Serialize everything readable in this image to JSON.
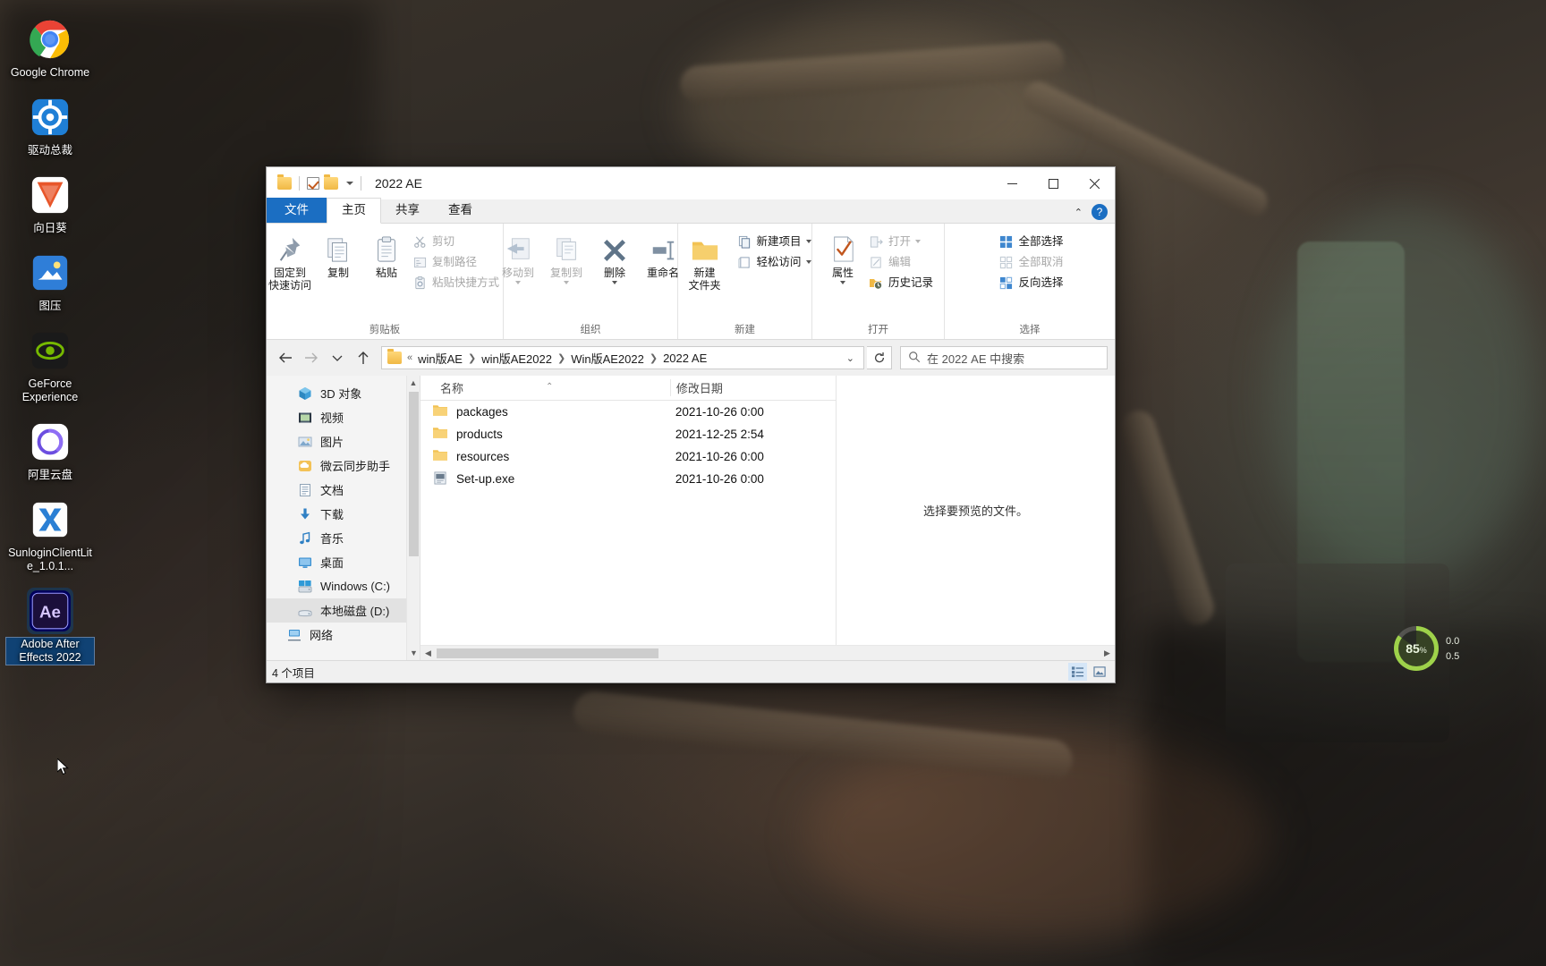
{
  "desktop": {
    "icons": [
      {
        "label": "Google Chrome",
        "icon": "chrome-icon",
        "selected": false
      },
      {
        "label": "驱动总裁",
        "icon": "driver-tool-icon",
        "selected": false
      },
      {
        "label": "向日葵",
        "icon": "sunflower-remote-icon",
        "selected": false
      },
      {
        "label": "图压",
        "icon": "image-compress-icon",
        "selected": false
      },
      {
        "label": "GeForce Experience",
        "icon": "geforce-experience-icon",
        "selected": false
      },
      {
        "label": "阿里云盘",
        "icon": "aliyun-drive-icon",
        "selected": false
      },
      {
        "label": "SunloginClientLite_1.0.1...",
        "icon": "sunlogin-installer-icon",
        "selected": false
      },
      {
        "label": "Adobe After Effects 2022",
        "icon": "after-effects-icon",
        "selected": true
      }
    ],
    "widget": {
      "percent": "85",
      "percent_unit": "%",
      "line1": "0.0",
      "line2": "0.5"
    }
  },
  "window": {
    "title": "2022 AE",
    "quick_access": {
      "folder_icon": "folder-icon",
      "properties_icon": "properties-check-icon",
      "new_folder_icon": "new-folder-icon",
      "customize_caret": "chevron-down-icon"
    },
    "controls": {
      "minimize": "−",
      "maximize": "□",
      "close": "✕"
    }
  },
  "ribbon": {
    "tabs": [
      {
        "label": "文件",
        "type": "file"
      },
      {
        "label": "主页",
        "type": "active"
      },
      {
        "label": "共享",
        "type": "normal"
      },
      {
        "label": "查看",
        "type": "normal"
      }
    ],
    "collapse_icon": "chevron-up-icon",
    "help_label": "?",
    "groups": [
      {
        "name": "剪贴板",
        "big_buttons": [
          {
            "label_line1": "固定到",
            "label_line2": "快速访问",
            "icon": "pin-icon",
            "dim": false
          },
          {
            "label_line1": "复制",
            "label_line2": "",
            "icon": "copy-icon",
            "dim": false
          },
          {
            "label_line1": "粘贴",
            "label_line2": "",
            "icon": "paste-icon",
            "dim": false
          }
        ],
        "small_buttons": [
          {
            "label": "剪切",
            "icon": "scissors-icon",
            "dim": true,
            "caret": false
          },
          {
            "label": "复制路径",
            "icon": "copy-path-icon",
            "dim": true,
            "caret": false
          },
          {
            "label": "粘贴快捷方式",
            "icon": "paste-shortcut-icon",
            "dim": true,
            "caret": false
          }
        ]
      },
      {
        "name": "组织",
        "big_buttons": [
          {
            "label_line1": "移动到",
            "label_line2": "",
            "icon": "move-to-icon",
            "dim": true,
            "caret": true
          },
          {
            "label_line1": "复制到",
            "label_line2": "",
            "icon": "copy-to-icon",
            "dim": true,
            "caret": true
          },
          {
            "label_line1": "删除",
            "label_line2": "",
            "icon": "delete-x-icon",
            "dim": false,
            "caret": true
          },
          {
            "label_line1": "重命名",
            "label_line2": "",
            "icon": "rename-icon",
            "dim": false,
            "caret": false
          }
        ],
        "small_buttons": []
      },
      {
        "name": "新建",
        "big_buttons": [
          {
            "label_line1": "新建",
            "label_line2": "文件夹",
            "icon": "new-folder-icon",
            "dim": false
          }
        ],
        "small_buttons": [
          {
            "label": "新建项目",
            "icon": "new-item-icon",
            "dim": false,
            "caret": true
          },
          {
            "label": "轻松访问",
            "icon": "easy-access-icon",
            "dim": false,
            "caret": true
          }
        ]
      },
      {
        "name": "打开",
        "big_buttons": [
          {
            "label_line1": "属性",
            "label_line2": "",
            "icon": "properties-check-icon",
            "dim": false,
            "caret": true
          }
        ],
        "small_buttons": [
          {
            "label": "打开",
            "icon": "open-icon",
            "dim": true,
            "caret": true
          },
          {
            "label": "编辑",
            "icon": "edit-icon",
            "dim": true,
            "caret": false
          },
          {
            "label": "历史记录",
            "icon": "history-icon",
            "dim": false,
            "caret": false
          }
        ]
      },
      {
        "name": "选择",
        "big_buttons": [],
        "small_buttons": [
          {
            "label": "全部选择",
            "icon": "select-all-icon",
            "dim": false,
            "caret": false
          },
          {
            "label": "全部取消",
            "icon": "select-none-icon",
            "dim": true,
            "caret": false
          },
          {
            "label": "反向选择",
            "icon": "invert-selection-icon",
            "dim": false,
            "caret": false
          }
        ]
      }
    ]
  },
  "address_bar": {
    "back_icon": "arrow-left-icon",
    "forward_icon": "arrow-right-icon",
    "recent_icon": "chevron-down-icon",
    "up_icon": "arrow-up-icon",
    "folder_icon": "folder-icon",
    "prefix": "«",
    "breadcrumbs": [
      "win版AE",
      "win版AE2022",
      "Win版AE2022",
      "2022 AE"
    ],
    "dropdown_icon": "chevron-down-icon",
    "refresh_icon": "refresh-icon",
    "search": {
      "icon": "search-icon",
      "placeholder": "在 2022 AE 中搜索",
      "value": ""
    }
  },
  "nav_pane": {
    "items": [
      {
        "label": "3D 对象",
        "icon": "3d-objects-icon",
        "selected": false
      },
      {
        "label": "视频",
        "icon": "videos-icon",
        "selected": false
      },
      {
        "label": "图片",
        "icon": "pictures-icon",
        "selected": false
      },
      {
        "label": "微云同步助手",
        "icon": "weiyun-sync-icon",
        "selected": false
      },
      {
        "label": "文档",
        "icon": "documents-icon",
        "selected": false
      },
      {
        "label": "下载",
        "icon": "downloads-icon",
        "selected": false
      },
      {
        "label": "音乐",
        "icon": "music-icon",
        "selected": false
      },
      {
        "label": "桌面",
        "icon": "desktop-icon",
        "selected": false
      },
      {
        "label": "Windows (C:)",
        "icon": "windows-drive-icon",
        "selected": false
      },
      {
        "label": "本地磁盘 (D:)",
        "icon": "local-drive-icon",
        "selected": true
      },
      {
        "label": "网络",
        "icon": "network-icon",
        "selected": false
      }
    ],
    "scroll_up_icon": "chevron-up-icon",
    "scroll_down_icon": "chevron-down-icon"
  },
  "file_list": {
    "columns": [
      {
        "label": "名称",
        "sorted": true,
        "sort_icon": "sort-asc-icon"
      },
      {
        "label": "修改日期",
        "sorted": false
      }
    ],
    "rows": [
      {
        "name": "packages",
        "date": "2021-10-26 0:00",
        "icon": "folder-icon",
        "type": "folder"
      },
      {
        "name": "products",
        "date": "2021-12-25 2:54",
        "icon": "folder-icon",
        "type": "folder"
      },
      {
        "name": "resources",
        "date": "2021-10-26 0:00",
        "icon": "folder-icon",
        "type": "folder"
      },
      {
        "name": "Set-up.exe",
        "date": "2021-10-26 0:00",
        "icon": "exe-icon",
        "type": "file"
      }
    ],
    "hscroll_left_icon": "chevron-left-icon",
    "hscroll_right_icon": "chevron-right-icon"
  },
  "preview_pane": {
    "message": "选择要预览的文件。"
  },
  "status_bar": {
    "count_text": "4 个项目",
    "view_buttons": [
      {
        "name": "details-view",
        "active": true
      },
      {
        "name": "large-icons-view",
        "active": false
      }
    ]
  },
  "colors": {
    "accent": "#1b6ec2",
    "file_tab": "#1b6ec2",
    "folder_yellow": "#f0b945",
    "selection": "#e2e2e2",
    "close_hover": "#e81123"
  }
}
